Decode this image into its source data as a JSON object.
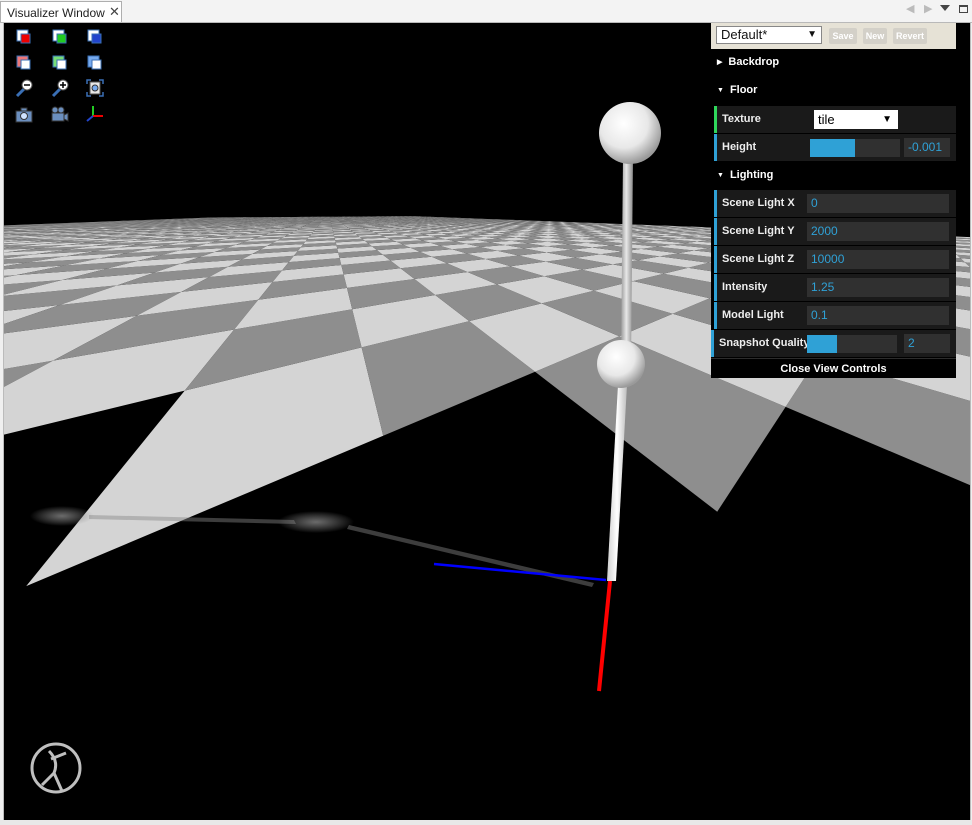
{
  "tab": {
    "title": "Visualizer Window",
    "close": "✕"
  },
  "controls": {
    "preset": "Default*",
    "save": "Save",
    "new": "New",
    "revert": "Revert",
    "backdrop": "Backdrop",
    "floor": "Floor",
    "texture_label": "Texture",
    "texture_value": "tile",
    "height_label": "Height",
    "height_value": "-0.001",
    "height_fill": 0.5,
    "lighting": "Lighting",
    "light_x_label": "Scene Light X",
    "light_x": "0",
    "light_y_label": "Scene Light Y",
    "light_y": "2000",
    "light_z_label": "Scene Light Z",
    "light_z": "10000",
    "intensity_label": "Intensity",
    "intensity": "1.25",
    "model_light_label": "Model Light",
    "model_light": "0.1",
    "snapshot_label": "Snapshot Quality",
    "snapshot_value": "2",
    "snapshot_fill": 0.33,
    "close": "Close View Controls"
  },
  "toolbar_icons": [
    "view-cube-red-icon",
    "view-cube-green-icon",
    "view-cube-blue-icon",
    "view-cube-magenta-icon",
    "view-cube-green-2-icon",
    "view-cube-blue-2-icon",
    "zoom-out-icon",
    "zoom-in-icon",
    "fit-view-icon",
    "snapshot-icon",
    "record-movie-icon",
    "axes-icon"
  ],
  "colors": {
    "accent": "#2fa1d6",
    "green_accent": "#2fd65b",
    "x_axis": "#ff0000",
    "z_axis": "#0000ff"
  }
}
